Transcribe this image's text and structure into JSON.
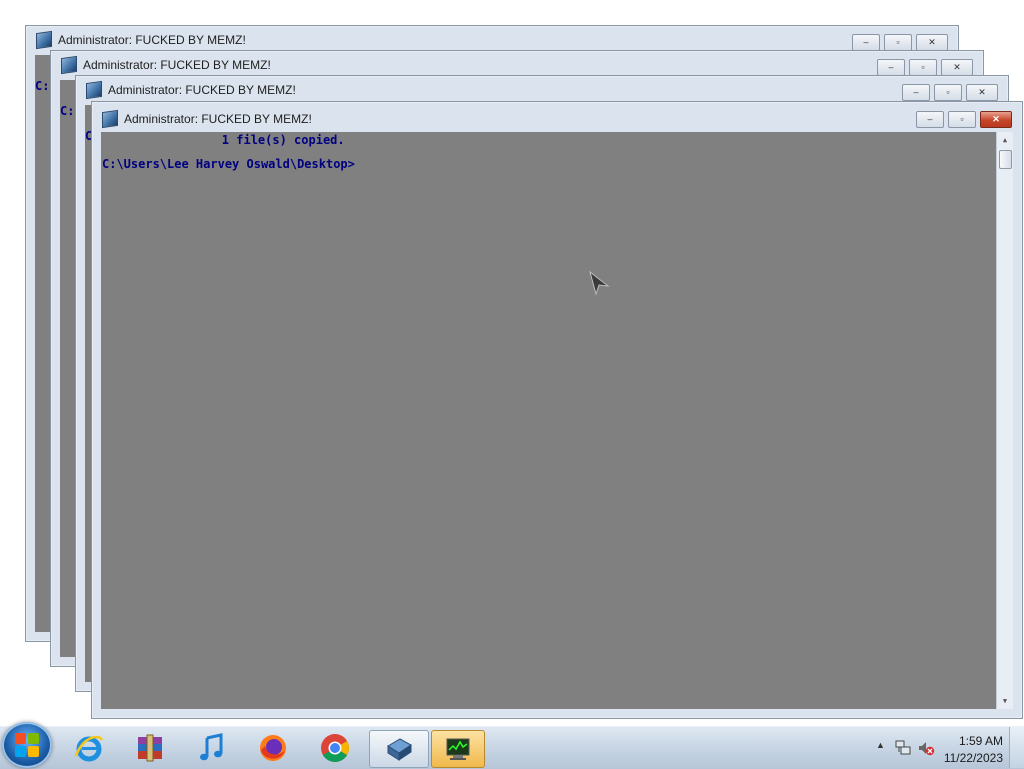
{
  "window_title": "Administrator:  FUCKED BY MEMZ!",
  "background_prompt_prefix": "C:",
  "console_lines": [
    "        1 file(s) copied.",
    "C:\\Users\\Lee Harvey Oswald\\Desktop>"
  ],
  "window_controls": {
    "minimize": "‒",
    "maximize": "▫",
    "close": "✕"
  },
  "taskbar": {
    "items": [
      {
        "name": "internet-explorer",
        "icon": "ie-icon"
      },
      {
        "name": "winrar",
        "icon": "archive-icon"
      },
      {
        "name": "itunes",
        "icon": "music-note-icon"
      },
      {
        "name": "firefox",
        "icon": "firefox-icon"
      },
      {
        "name": "chrome",
        "icon": "chrome-icon"
      },
      {
        "name": "command-prompt",
        "icon": "cmd-icon"
      },
      {
        "name": "task-manager",
        "icon": "task-manager-icon"
      }
    ]
  },
  "tray": {
    "time": "1:59 AM",
    "date": "11/22/2023",
    "icons": [
      "show-hidden-icons-caret",
      "network-icon",
      "volume-muted-icon"
    ]
  },
  "colors": {
    "console_bg": "#808080",
    "console_text": "#000080",
    "window_frame": "#dbe4ee",
    "close_red": "#c7462b"
  }
}
